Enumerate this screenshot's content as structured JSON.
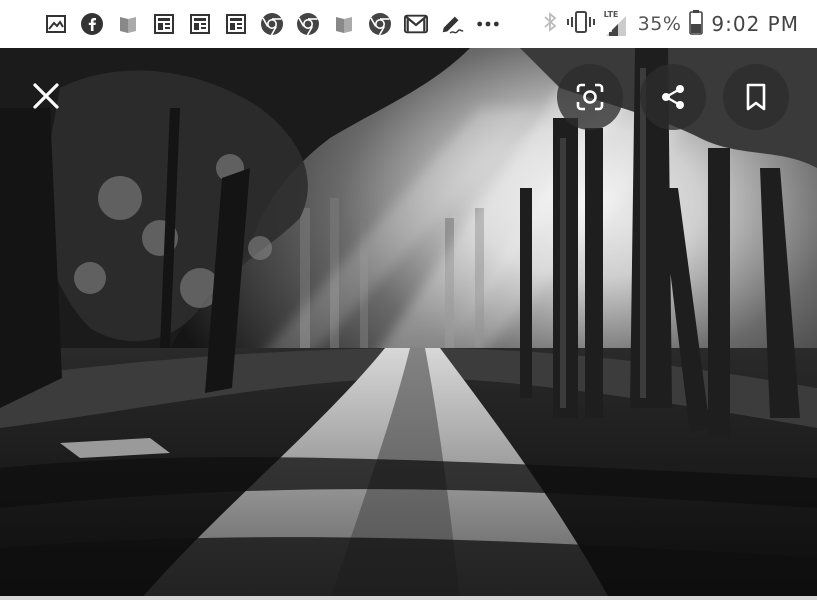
{
  "status_bar": {
    "notification_icons": [
      "gallery-icon",
      "facebook-icon",
      "google-play-books-icon",
      "news-icon",
      "news-icon",
      "news-icon",
      "chrome-icon",
      "chrome-icon",
      "google-play-books-icon",
      "chrome-icon",
      "gmail-icon",
      "signature-icon",
      "more-icon"
    ],
    "network_label": "LTE",
    "battery": "35%",
    "time": "9:02 PM"
  },
  "viewer": {
    "image": "grayscale-forest-path-photo",
    "actions": [
      "close-icon",
      "google-lens-icon",
      "share-icon",
      "bookmark-icon"
    ]
  },
  "colors": {
    "status_bar_bg": "#ffffff",
    "button_bg": "#2d2d2d",
    "icon_fg": "#ffffff"
  }
}
